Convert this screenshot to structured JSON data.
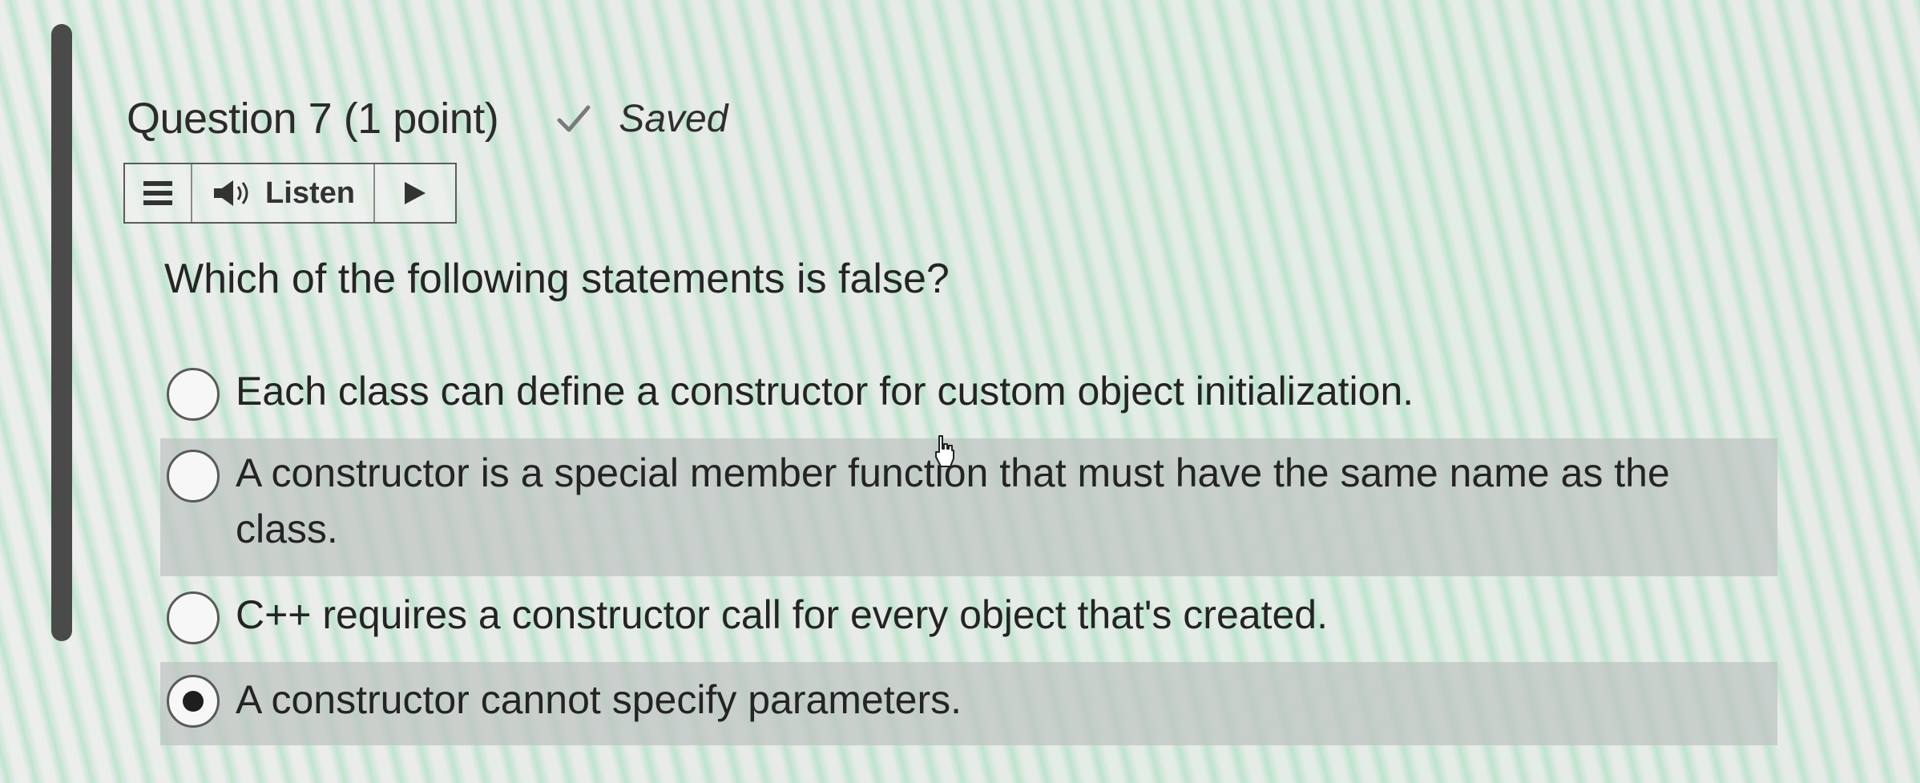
{
  "question": {
    "title": "Question 7",
    "points": "(1 point)",
    "status": "Saved",
    "status_icon": "check-icon",
    "prompt": "Which of the following statements is false?"
  },
  "listen_toolbar": {
    "menu_icon": "hamburger-menu-icon",
    "speaker_icon": "speaker-icon",
    "listen_label": "Listen",
    "play_icon": "play-icon"
  },
  "options": [
    {
      "label": "Each class can define a constructor for custom object initialization.",
      "selected": false,
      "highlighted": false
    },
    {
      "label": "A constructor is a special member function that must have the same name as the class.",
      "selected": false,
      "highlighted": true
    },
    {
      "label": "C++ requires a constructor call for every object that's created.",
      "selected": false,
      "highlighted": false
    },
    {
      "label": "A constructor cannot specify parameters.",
      "selected": true,
      "highlighted": true
    }
  ],
  "colors": {
    "text": "#252525",
    "highlight": "#bec4c0",
    "border": "#5b5b5b"
  }
}
